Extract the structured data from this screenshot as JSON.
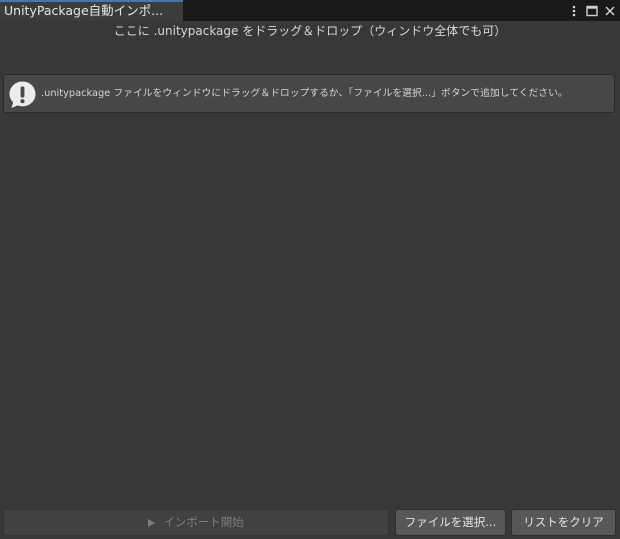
{
  "window": {
    "tab_title": "UnityPackage自動インポ...",
    "controls": [
      "more-vert-icon",
      "maximize-icon",
      "close-icon"
    ]
  },
  "drop_area": {
    "label": "ここに .unitypackage をドラッグ＆ドロップ（ウィンドウ全体でも可）"
  },
  "help_box": {
    "icon": "info-exclamation-icon",
    "message": ".unitypackage ファイルをウィンドウにドラッグ＆ドロップするか、「ファイルを選択...」ボタンで追加してください。"
  },
  "footer": {
    "import_label": "インポート開始",
    "import_enabled": false,
    "select_label": "ファイルを選択...",
    "clear_label": "リストをクリア"
  },
  "colors": {
    "background": "#383838",
    "tab_accent": "#3a79bb",
    "helpbox": "#474747"
  }
}
